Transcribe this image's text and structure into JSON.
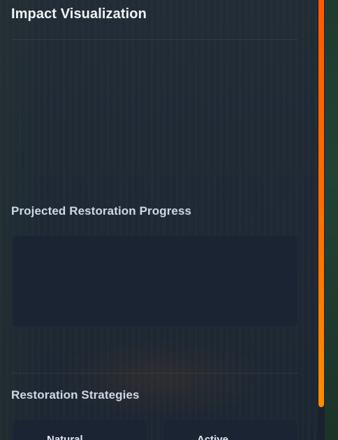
{
  "panel": {
    "title": "Impact Visualization",
    "progress": {
      "title": "Projected Restoration Progress"
    },
    "strategies": {
      "title": "Restoration Strategies",
      "cards": [
        {
          "label": "Natural"
        },
        {
          "label": "Active"
        }
      ]
    }
  },
  "colors": {
    "scroll_thumb_top": "#ff5a00",
    "scroll_thumb_bottom": "#ff8c00",
    "panel_bg": "#1d2733",
    "card_bg": "#1b2433"
  }
}
